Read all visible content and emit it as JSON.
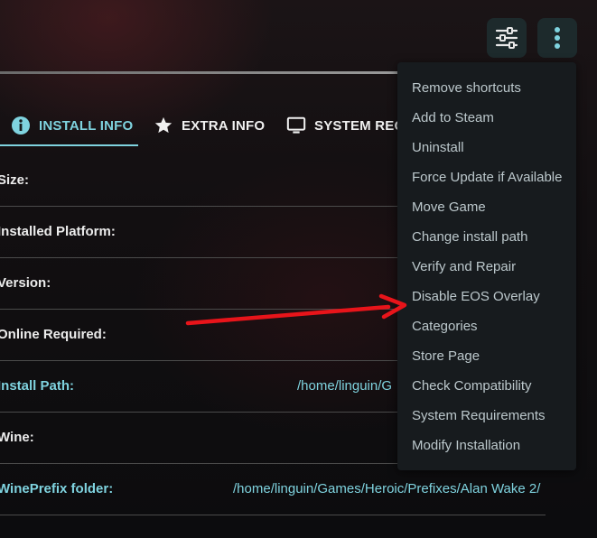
{
  "tabs": [
    {
      "label": "INSTALL INFO",
      "icon": "info-icon",
      "active": true
    },
    {
      "label": "EXTRA INFO",
      "icon": "star-icon",
      "active": false
    },
    {
      "label": "SYSTEM REQUIREMENTS",
      "icon": "monitor-icon",
      "active": false
    }
  ],
  "tab_visible_labels": {
    "system": "SYSTEM REQU"
  },
  "info_rows": [
    {
      "label": "Size:",
      "value": ""
    },
    {
      "label": "Installed Platform:",
      "value": ""
    },
    {
      "label": "Version:",
      "value": ""
    },
    {
      "label": "Online Required:",
      "value": ""
    },
    {
      "label": "Install Path:",
      "value": "/home/linguin/G"
    },
    {
      "label": "Wine:",
      "value": ""
    },
    {
      "label": "WinePrefix folder:",
      "value": "/home/linguin/Games/Heroic/Prefixes/Alan Wake 2/"
    }
  ],
  "header": {
    "filter_icon": "sliders-icon",
    "menu_icon": "vertical-dots-icon"
  },
  "menu": {
    "items": [
      "Remove shortcuts",
      "Add to Steam",
      "Uninstall",
      "Force Update if Available",
      "Move Game",
      "Change install path",
      "Verify and Repair",
      "Disable EOS Overlay",
      "Categories",
      "Store Page",
      "Check Compatibility",
      "System Requirements",
      "Modify Installation"
    ]
  },
  "colors": {
    "accent": "#7fd3df",
    "arrow": "#e8141a",
    "menu_bg": "#171b1e",
    "menu_text": "#bcc8cc"
  }
}
